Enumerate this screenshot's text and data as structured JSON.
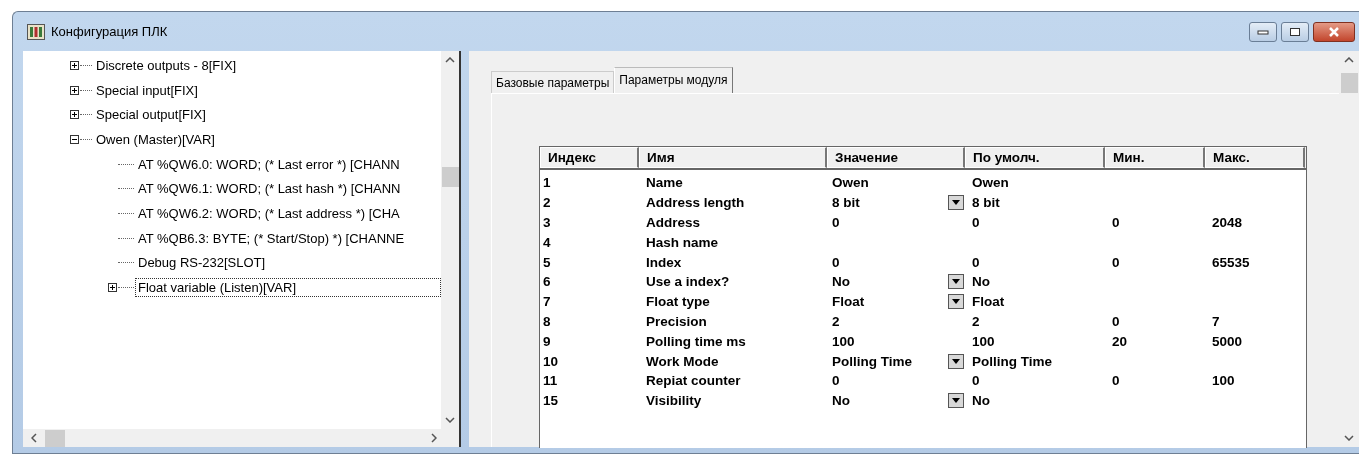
{
  "window": {
    "title": "Конфигурация ПЛК"
  },
  "tree": [
    {
      "label": "Discrete outputs - 8[FIX]",
      "expanded": false,
      "selected": false
    },
    {
      "label": "Special input[FIX]",
      "expanded": false,
      "selected": false
    },
    {
      "label": "Special output[FIX]",
      "expanded": false,
      "selected": false
    },
    {
      "label": "Owen (Master)[VAR]",
      "expanded": true,
      "selected": false,
      "children": [
        {
          "label": "AT %QW6.0: WORD; (* Last error *) [CHANN",
          "selected": false
        },
        {
          "label": "AT %QW6.1: WORD; (* Last hash *) [CHANN",
          "selected": false
        },
        {
          "label": "AT %QW6.2: WORD; (* Last address *) [CHA",
          "selected": false
        },
        {
          "label": "AT %QB6.3: BYTE; (* Start/Stop) *) [CHANNE",
          "selected": false
        },
        {
          "label": "Debug RS-232[SLOT]",
          "selected": false
        },
        {
          "label": "Float variable (Listen)[VAR]",
          "expanded": false,
          "selected": true
        }
      ]
    }
  ],
  "tabs": [
    {
      "label": "Базовые параметры",
      "selected": false
    },
    {
      "label": "Параметры модуля",
      "selected": true
    }
  ],
  "table": {
    "columns": [
      "Индекс",
      "Имя",
      "Значение",
      "По умолч.",
      "Мин.",
      "Макс."
    ],
    "rows": [
      {
        "index": "1",
        "name": "Name",
        "value": "Owen",
        "default": "Owen",
        "min": "",
        "max": "",
        "dropdown": false
      },
      {
        "index": "2",
        "name": "Address length",
        "value": "8 bit",
        "default": "8 bit",
        "min": "",
        "max": "",
        "dropdown": true
      },
      {
        "index": "3",
        "name": "Address",
        "value": "0",
        "default": "0",
        "min": "0",
        "max": "2048",
        "dropdown": false
      },
      {
        "index": "4",
        "name": "Hash name",
        "value": "",
        "default": "",
        "min": "",
        "max": "",
        "dropdown": false
      },
      {
        "index": "5",
        "name": "Index",
        "value": "0",
        "default": "0",
        "min": "0",
        "max": "65535",
        "dropdown": false
      },
      {
        "index": "6",
        "name": "Use a index?",
        "value": "No",
        "default": "No",
        "min": "",
        "max": "",
        "dropdown": true
      },
      {
        "index": "7",
        "name": "Float type",
        "value": "Float",
        "default": "Float",
        "min": "",
        "max": "",
        "dropdown": true
      },
      {
        "index": "8",
        "name": "Precision",
        "value": "2",
        "default": "2",
        "min": "0",
        "max": "7",
        "dropdown": false
      },
      {
        "index": "9",
        "name": "Polling time ms",
        "value": "100",
        "default": "100",
        "min": "20",
        "max": "5000",
        "dropdown": false
      },
      {
        "index": "10",
        "name": "Work Mode",
        "value": "Polling Time",
        "default": "Polling Time",
        "min": "",
        "max": "",
        "dropdown": true
      },
      {
        "index": "11",
        "name": "Repiat counter",
        "value": "0",
        "default": "0",
        "min": "0",
        "max": "100",
        "dropdown": false
      },
      {
        "index": "15",
        "name": "Visibility",
        "value": "No",
        "default": "No",
        "min": "",
        "max": "",
        "dropdown": true
      }
    ]
  }
}
